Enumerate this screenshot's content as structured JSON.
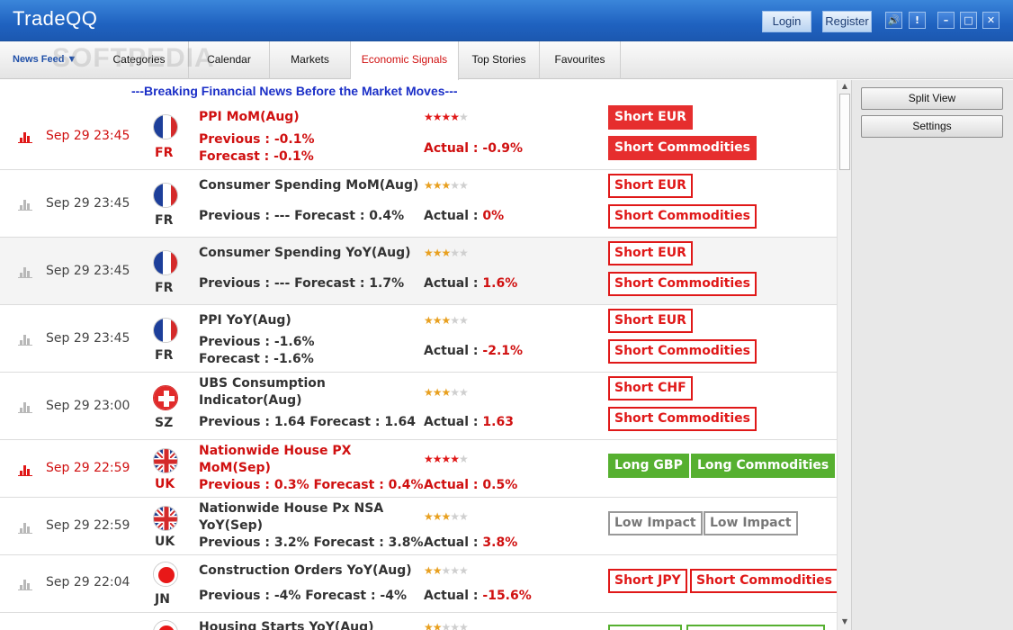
{
  "app": {
    "title": "TradeQQ",
    "login": "Login",
    "register": "Register"
  },
  "window_buttons": {
    "sound": "🔊",
    "alert": "!",
    "minimize": "–",
    "maximize": "□",
    "close": "✕"
  },
  "tabs": [
    {
      "label": "News Feed ▼"
    },
    {
      "label": "Categories"
    },
    {
      "label": "Calendar"
    },
    {
      "label": "Markets"
    },
    {
      "label": "Economic Signals"
    },
    {
      "label": "Top Stories"
    },
    {
      "label": "Favourites"
    }
  ],
  "watermark": "SOFTPEDIA",
  "breaking": "---Breaking Financial News Before the Market Moves---",
  "side": {
    "split_view": "Split View",
    "settings": "Settings"
  },
  "events": [
    {
      "time": "Sep 29 23:45",
      "country": "FR",
      "name": "PPI MoM(Aug)",
      "line1": "Previous : -0.1%",
      "line2": "Forecast : -0.1%",
      "actual_label": "Actual : ",
      "actual_value": "-0.9%",
      "stars": 4,
      "signals": [
        "Short EUR",
        "Short Commodities"
      ]
    },
    {
      "time": "Sep 29 23:45",
      "country": "FR",
      "name": "Consumer Spending MoM(Aug)",
      "line1": "Previous : --- Forecast : 0.4%",
      "actual_label": "Actual : ",
      "actual_value": "0%",
      "stars": 3,
      "signals": [
        "Short EUR",
        "Short Commodities"
      ]
    },
    {
      "time": "Sep 29 23:45",
      "country": "FR",
      "name": "Consumer Spending YoY(Aug)",
      "line1": "Previous : --- Forecast : 1.7%",
      "actual_label": "Actual : ",
      "actual_value": "1.6%",
      "stars": 3,
      "signals": [
        "Short EUR",
        "Short Commodities"
      ]
    },
    {
      "time": "Sep 29 23:45",
      "country": "FR",
      "name": "PPI YoY(Aug)",
      "line1": "Previous : -1.6%",
      "line2": "Forecast : -1.6%",
      "actual_label": "Actual : ",
      "actual_value": "-2.1%",
      "stars": 3,
      "signals": [
        "Short EUR",
        "Short Commodities"
      ]
    },
    {
      "time": "Sep 29 23:00",
      "country": "SZ",
      "name": "UBS Consumption Indicator(Aug)",
      "line1": "Previous : 1.64 Forecast : 1.64",
      "actual_label": "Actual : ",
      "actual_value": "1.63",
      "stars": 3,
      "signals": [
        "Short CHF",
        "Short Commodities"
      ]
    },
    {
      "time": "Sep 29 22:59",
      "country": "UK",
      "name": "Nationwide House PX MoM(Sep)",
      "line1": "Previous : 0.3% Forecast : 0.4%",
      "actual_label": "Actual : ",
      "actual_value": "0.5%",
      "stars": 4,
      "signals": [
        "Long GBP",
        "Long Commodities"
      ]
    },
    {
      "time": "Sep 29 22:59",
      "country": "UK",
      "name": "Nationwide House Px NSA YoY(Sep)",
      "line1": "Previous : 3.2% Forecast : 3.8%",
      "actual_label": "Actual : ",
      "actual_value": "3.8%",
      "stars": 3,
      "signals": [
        "Low Impact",
        "Low Impact"
      ]
    },
    {
      "time": "Sep 29 22:04",
      "country": "JN",
      "name": "Construction Orders YoY(Aug)",
      "line1": "Previous : -4% Forecast : -4%",
      "actual_label": "Actual : ",
      "actual_value": "-15.6%",
      "stars": 2,
      "signals": [
        "Short JPY",
        "Short Commodities"
      ]
    },
    {
      "time": "",
      "country": "",
      "name": "Housing Starts YoY(Aug)",
      "stars": 2
    }
  ]
}
